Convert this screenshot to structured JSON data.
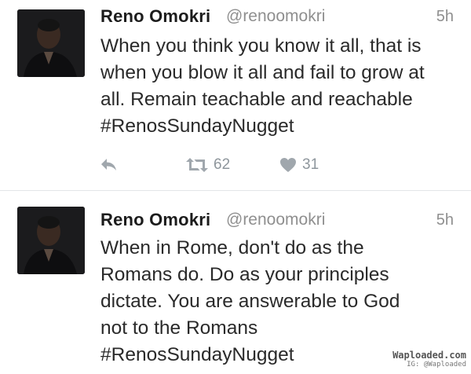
{
  "tweets": [
    {
      "name": "Reno Omokri",
      "handle": "@renoomokri",
      "time": "5h",
      "lines": [
        "When you think you know it all, that is",
        "when you blow it all and fail to grow at",
        "all. Remain teachable and reachable",
        "#RenosSundayNugget"
      ],
      "icons": {
        "avatar": "profile-photo",
        "reply": "reply-icon",
        "retweet": "retweet-icon",
        "like": "heart-icon"
      },
      "retweets": "62",
      "likes": "31"
    },
    {
      "name": "Reno Omokri",
      "handle": "@renoomokri",
      "time": "5h",
      "lines": [
        "When in Rome, don't do as the",
        "Romans do. Do as your principles",
        "dictate. You are answerable to God",
        "not to the Romans",
        "#RenosSundayNugget"
      ],
      "icons": {
        "avatar": "profile-photo"
      }
    }
  ],
  "watermark": {
    "main": "Waploaded.com",
    "sub": "IG: @Waploaded"
  },
  "colors": {
    "text": "#2a2a2a",
    "muted": "#8f8f8f",
    "icon": "#a0a7ad",
    "divider": "#e3e6e8"
  }
}
